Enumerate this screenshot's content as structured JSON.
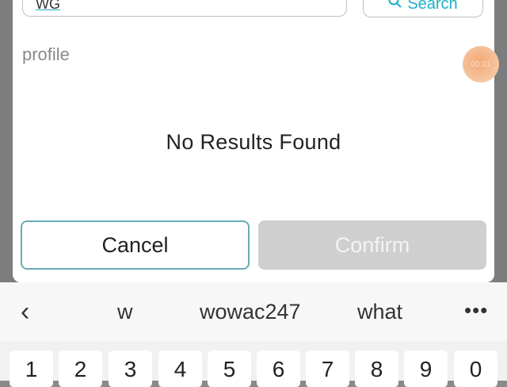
{
  "search": {
    "value": "WG",
    "button_label": "Search"
  },
  "section_label": "profile",
  "timer_label": "00:01",
  "empty_message": "No Results Found",
  "actions": {
    "cancel_label": "Cancel",
    "confirm_label": "Confirm"
  },
  "keyboard": {
    "back_symbol": "‹",
    "suggestions": [
      "w",
      "wowac247",
      "what"
    ],
    "more_symbol": "•••",
    "number_keys": [
      "1",
      "2",
      "3",
      "4",
      "5",
      "6",
      "7",
      "8",
      "9",
      "0"
    ]
  },
  "colors": {
    "accent": "#1ab0c4",
    "confirm_disabled": "#cfcfcf",
    "cancel_border": "#6aaab4"
  }
}
